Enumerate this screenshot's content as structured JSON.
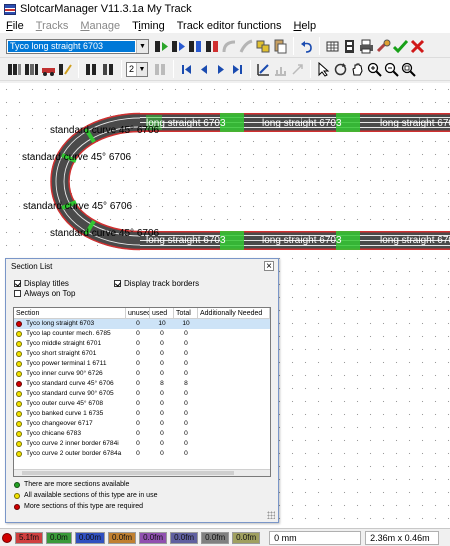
{
  "window": {
    "title": "SlotcarManager V11.3.1a My Track"
  },
  "menu": {
    "items": [
      {
        "label": "File",
        "underline": "F",
        "rest": "ile"
      },
      {
        "label": "Tracks",
        "underline": "T",
        "rest": "racks"
      },
      {
        "label": "Manage",
        "underline": "M",
        "rest": "anage"
      },
      {
        "label": "Timing",
        "underline": "i",
        "pre": "T",
        "rest": "ming"
      },
      {
        "label": "Track editor functions",
        "underline": "",
        "rest": "Track editor functions"
      },
      {
        "label": "Help",
        "underline": "H",
        "rest": "elp"
      }
    ]
  },
  "toolbar": {
    "selected_section": "Tyco long straight 6703",
    "lane_count": "2"
  },
  "track_labels": {
    "label_1": "standard curve 45° 6706",
    "label_2": "standard curve 45° 6706",
    "label_3": "standard curve 45° 6706",
    "label_4": "standard curve 45° 6706",
    "straight_top_1": "long straight 6703",
    "straight_top_2": "long straight 6703",
    "straight_top_3": "long straight 670",
    "straight_bot_1": "long straight 6703",
    "straight_bot_2": "long straight 6703",
    "straight_bot_3": "long straight 6703"
  },
  "section_list": {
    "title": "Section List",
    "options": {
      "display_titles": "Display titles",
      "always_on_top": "Always on Top",
      "display_track_borders": "Display track borders"
    },
    "columns": [
      "Section",
      "unused",
      "used",
      "Total",
      "Additionally Needed"
    ],
    "rows": [
      {
        "name": "Tyco long straight 6703",
        "unused": "0",
        "used": "10",
        "total": "10",
        "status": "red",
        "selected": true
      },
      {
        "name": "Tyco lap counter mech. 6785",
        "unused": "0",
        "used": "0",
        "total": "0",
        "status": "yellow"
      },
      {
        "name": "Tyco middle straight 6701",
        "unused": "0",
        "used": "0",
        "total": "0",
        "status": "yellow"
      },
      {
        "name": "Tyco short straight 6701",
        "unused": "0",
        "used": "0",
        "total": "0",
        "status": "yellow"
      },
      {
        "name": "Tyco power terminal 1 6711",
        "unused": "0",
        "used": "0",
        "total": "0",
        "status": "yellow"
      },
      {
        "name": "Tyco inner curve 90° 6726",
        "unused": "0",
        "used": "0",
        "total": "0",
        "status": "yellow"
      },
      {
        "name": "Tyco standard curve 45° 6706",
        "unused": "0",
        "used": "8",
        "total": "8",
        "status": "red"
      },
      {
        "name": "Tyco standard curve 90° 6705",
        "unused": "0",
        "used": "0",
        "total": "0",
        "status": "yellow"
      },
      {
        "name": "Tyco outer curve 45° 6708",
        "unused": "0",
        "used": "0",
        "total": "0",
        "status": "yellow"
      },
      {
        "name": "Tyco banked curve 1 6735",
        "unused": "0",
        "used": "0",
        "total": "0",
        "status": "yellow"
      },
      {
        "name": "Tyco changeover 6717",
        "unused": "0",
        "used": "0",
        "total": "0",
        "status": "yellow"
      },
      {
        "name": "Tyco chicane 6783",
        "unused": "0",
        "used": "0",
        "total": "0",
        "status": "yellow"
      },
      {
        "name": "Tyco curve 2 inner border 6784i",
        "unused": "0",
        "used": "0",
        "total": "0",
        "status": "yellow"
      },
      {
        "name": "Tyco curve 2 outer border 6784a",
        "unused": "0",
        "used": "0",
        "total": "0",
        "status": "yellow"
      }
    ],
    "legend": [
      {
        "color": "green",
        "text": "There are more sections available"
      },
      {
        "color": "yellow",
        "text": "All available sections of this type are in use"
      },
      {
        "color": "red",
        "text": "More sections of this type are required"
      }
    ]
  },
  "statusbar": {
    "boxes": [
      "5.1fm",
      "0.0m",
      "0.00m",
      "0.0fm",
      "0.0fm",
      "0.0fm",
      "0.0fm",
      "0.0fm"
    ],
    "box_colors": [
      "#d04040",
      "#3a9a3a",
      "#3050c0",
      "#c08030",
      "#9050b0",
      "#6060a0",
      "#808080",
      "#a0a060"
    ],
    "position": "0 mm",
    "size": "2.36m x 0.46m"
  },
  "colors": {
    "status_red": "#d00000",
    "status_yellow": "#f2e200",
    "status_green": "#22a022",
    "track_body": "#4a4a4a",
    "track_border": "#d03030",
    "track_joint": "#32c832"
  }
}
